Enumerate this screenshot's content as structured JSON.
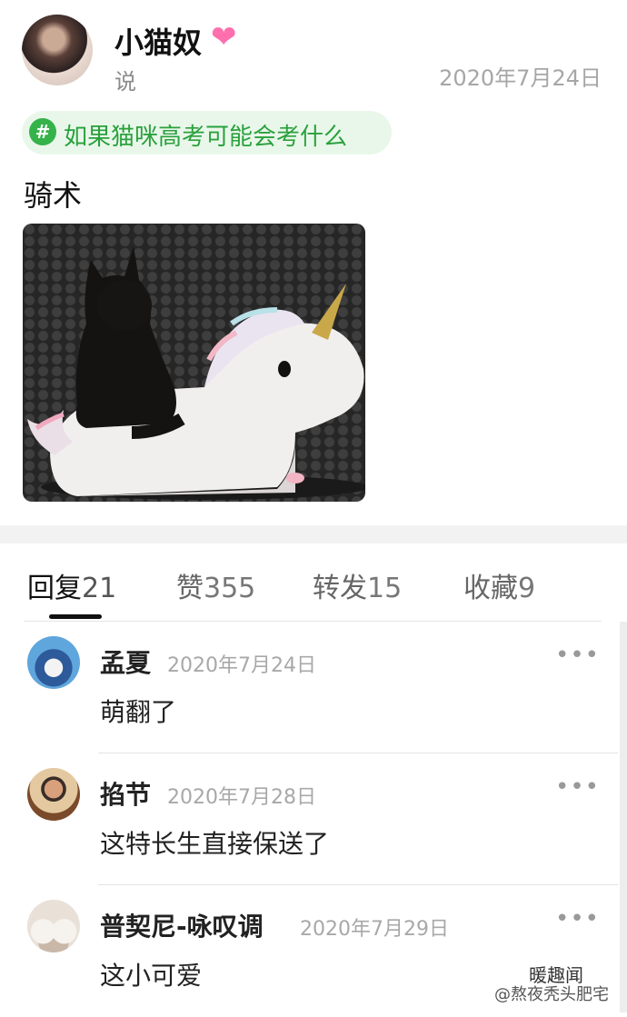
{
  "post": {
    "author": "小猫奴",
    "verb": "说",
    "date": "2020年7月24日",
    "topic": "如果猫咪高考可能会考什么",
    "topic_icon": "#",
    "body": "骑术",
    "heart_icon": "heart-icon"
  },
  "tabs": [
    {
      "label": "回复",
      "count": "21"
    },
    {
      "label": "赞",
      "count": "355"
    },
    {
      "label": "转发",
      "count": "15"
    },
    {
      "label": "收藏",
      "count": "9"
    }
  ],
  "comments": [
    {
      "name": "孟夏",
      "date": "2020年7月24日",
      "text": "萌翻了",
      "more": "•••"
    },
    {
      "name": "掐节",
      "date": "2020年7月28日",
      "text": "这特长生直接保送了",
      "more": "•••"
    },
    {
      "name": "普契尼-咏叹调",
      "date": "2020年7月29日",
      "text": "这小可爱",
      "more": "•••"
    }
  ],
  "watermark": {
    "top": "暖趣闻",
    "bottom": "@熬夜秃头肥宅"
  },
  "colors": {
    "topic_green": "#2aa13d",
    "topic_bg": "#e9f7ea",
    "heart": "#ff6fae"
  }
}
